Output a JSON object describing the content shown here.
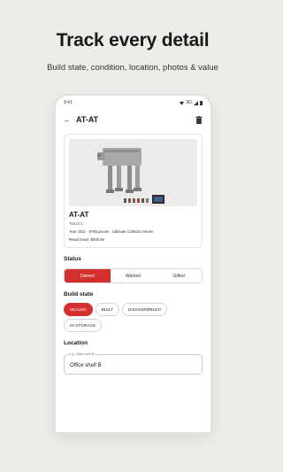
{
  "promo": {
    "headline": "Track every detail",
    "subhead": "Build state, condition, location, photos & value"
  },
  "statusbar": {
    "time": "9:41",
    "network": "3G"
  },
  "appbar": {
    "title": "AT-AT",
    "back_icon": "arrow-left-icon",
    "delete_icon": "trash-icon"
  },
  "set_card": {
    "name": "AT-AT",
    "set_number": "75313-1",
    "meta": "Year 2021 · 6785 pieces · Ultimate Collector Series",
    "retail": "Retail (new): $849.99"
  },
  "status": {
    "heading": "Status",
    "options": [
      "Owned",
      "Wanted",
      "Gifted"
    ],
    "selected": "Owned"
  },
  "build_state": {
    "heading": "Build state",
    "chips": [
      "SEALED",
      "BUILT",
      "DISASSEMBLED",
      "IN STORAGE"
    ],
    "selected": "SEALED"
  },
  "location": {
    "heading": "Location",
    "placeholder": "e.g. Office shelf B",
    "value": "Office shelf B"
  },
  "colors": {
    "accent": "#d32f2f",
    "background": "#eeece8"
  }
}
